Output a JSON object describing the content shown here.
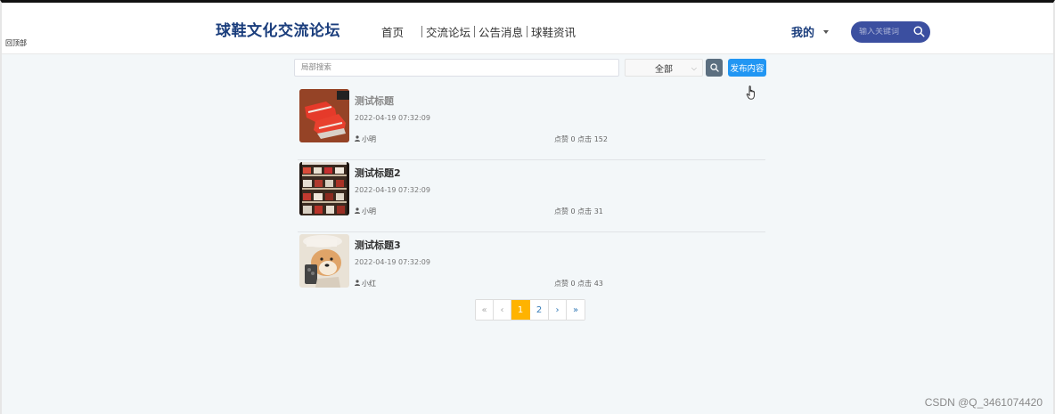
{
  "corner_text": "回顶部",
  "header": {
    "site_title": "球鞋文化交流论坛",
    "nav": [
      {
        "label": "首页"
      },
      {
        "label": "交流论坛"
      },
      {
        "label": "公告消息"
      },
      {
        "label": "球鞋资讯"
      }
    ],
    "user_menu_label": "我的",
    "search_placeholder": "输入关键词"
  },
  "toolbar": {
    "local_search_placeholder": "局部搜索",
    "category_selected": "全部",
    "publish_label": "发布内容"
  },
  "posts": [
    {
      "title": "测试标题",
      "date": "2022-04-19 07:32:09",
      "author": "小明",
      "stats": "点赞 0 点击 152",
      "image": "red-sneakers-image"
    },
    {
      "title": "测试标题2",
      "date": "2022-04-19 07:32:09",
      "author": "小明",
      "stats": "点赞 0 点击 31",
      "image": "shoe-shelf-image"
    },
    {
      "title": "测试标题3",
      "date": "2022-04-19 07:32:09",
      "author": "小红",
      "stats": "点赞 0 点击 43",
      "image": "shiba-dog-image"
    }
  ],
  "pagination": {
    "first": "«",
    "prev": "‹",
    "pages": [
      "1",
      "2"
    ],
    "active_page": "1",
    "next": "›",
    "last": "»"
  },
  "watermark": "CSDN @Q_3461074420",
  "colors": {
    "brand": "#1a3d7c",
    "publish": "#2196f3",
    "active_page": "#ffb300",
    "search_pill": "#3b4fa0"
  }
}
